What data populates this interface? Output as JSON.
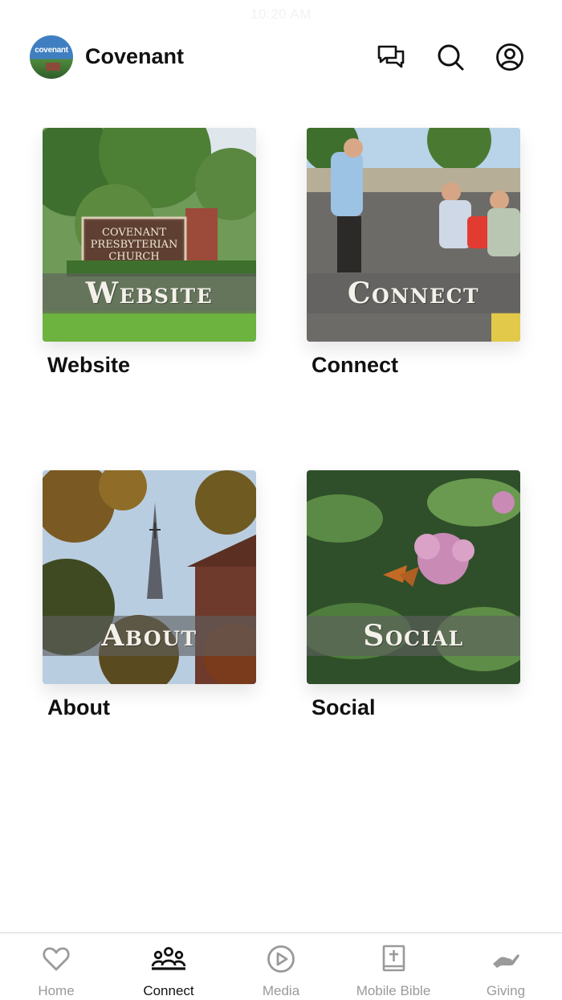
{
  "status": {
    "time": "10:20 AM"
  },
  "header": {
    "logo_text": "covenant",
    "title": "Covenant"
  },
  "tiles": [
    {
      "banner": "Website",
      "label": "Website"
    },
    {
      "banner": "Connect",
      "label": "Connect"
    },
    {
      "banner": "About",
      "label": "About"
    },
    {
      "banner": "Social",
      "label": "Social"
    }
  ],
  "website_sign": [
    "COVENANT",
    "PRESBYTERIAN",
    "CHURCH"
  ],
  "tabbar": {
    "items": [
      {
        "label": "Home",
        "icon": "heart-icon"
      },
      {
        "label": "Connect",
        "icon": "people-icon",
        "active": true
      },
      {
        "label": "Media",
        "icon": "play-circle-icon"
      },
      {
        "label": "Mobile Bible",
        "icon": "bible-icon"
      },
      {
        "label": "Giving",
        "icon": "giving-hand-icon"
      }
    ]
  },
  "colors": {
    "active": "#111111",
    "inactive": "#9a9a9a"
  }
}
